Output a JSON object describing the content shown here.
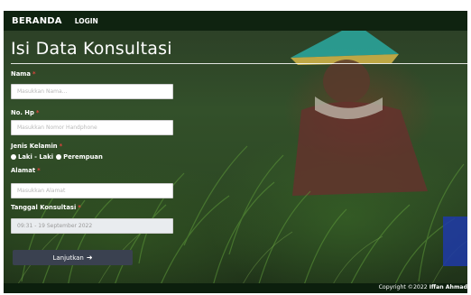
{
  "navbar": {
    "brand": "BERANDA",
    "links": [
      "LOGIN"
    ]
  },
  "page": {
    "title": "Isi Data Konsultasi"
  },
  "form": {
    "nama": {
      "label": "Nama",
      "required_mark": "*",
      "placeholder": "Masukkan Nama..."
    },
    "no_hp": {
      "label": "No. Hp",
      "required_mark": "*",
      "placeholder": "Masukkan Nomor Handphone"
    },
    "jenis_kelamin": {
      "label": "Jenis Kelamin",
      "required_mark": "*",
      "options": [
        "Laki - Laki",
        "Perempuan"
      ]
    },
    "alamat": {
      "label": "Alamat",
      "required_mark": "*",
      "placeholder": "Masukkan Alamat"
    },
    "tanggal": {
      "label": "Tanggal Konsultasi",
      "required_mark": "*",
      "value": "09:31 - 19 September 2022"
    },
    "submit": {
      "label": "Lanjutkan",
      "icon": "arrow-right-icon"
    }
  },
  "footer": {
    "copyright_prefix": "Copyright ©2022",
    "author": "Iffan Ahmad"
  },
  "colors": {
    "navbar": "#0f2310",
    "button": "#3a4150",
    "required": "#e0433c"
  }
}
